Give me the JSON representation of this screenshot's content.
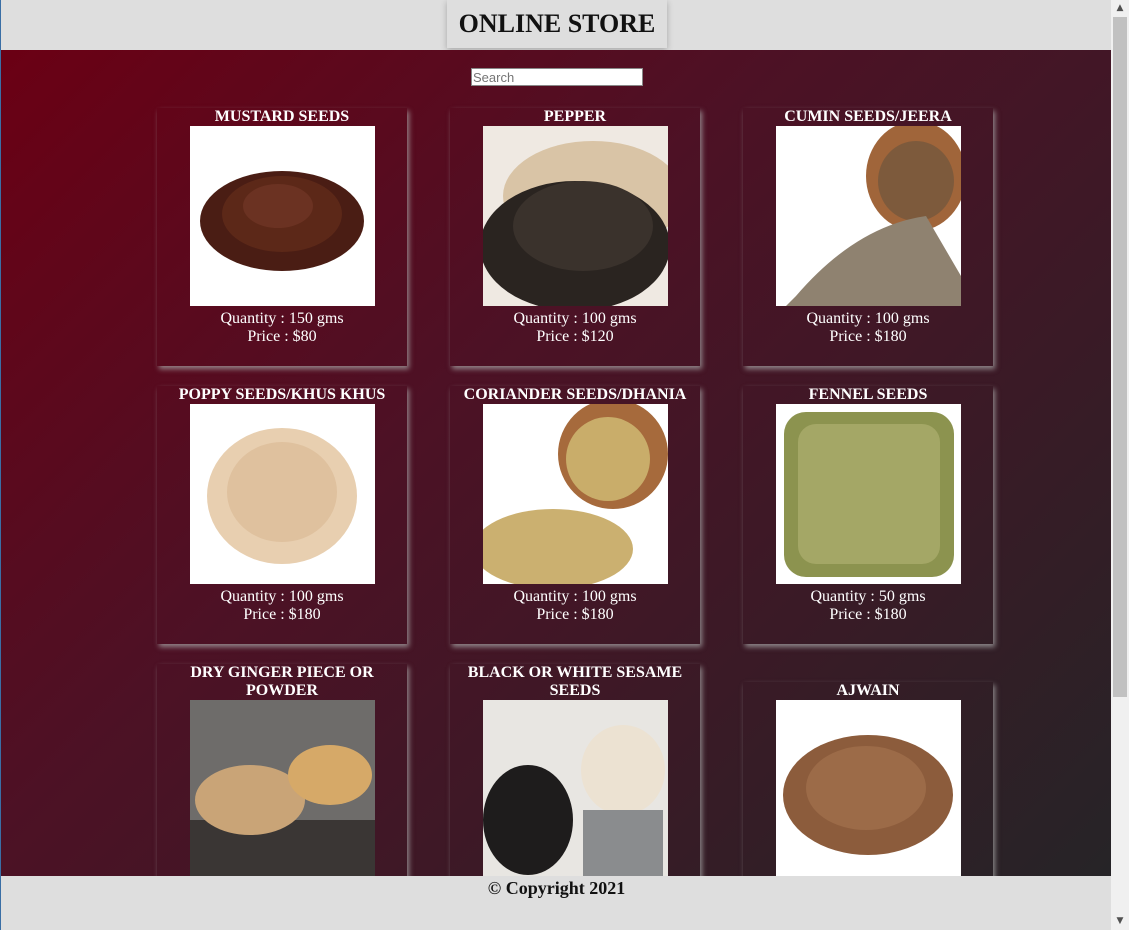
{
  "header": {
    "title": "ONLINE STORE"
  },
  "search": {
    "placeholder": "Search"
  },
  "products": [
    {
      "name": "MUSTARD SEEDS",
      "quantity": "Quantity : 150 gms",
      "price": "Price : $80",
      "image": "mustard-seeds"
    },
    {
      "name": "PEPPER",
      "quantity": "Quantity : 100 gms",
      "price": "Price : $120",
      "image": "black-pepper"
    },
    {
      "name": "CUMIN SEEDS/JEERA",
      "quantity": "Quantity : 100 gms",
      "price": "Price : $180",
      "image": "cumin-seeds"
    },
    {
      "name": "POPPY SEEDS/KHUS KHUS",
      "quantity": "Quantity : 100 gms",
      "price": "Price : $180",
      "image": "poppy-seeds"
    },
    {
      "name": "CORIANDER SEEDS/DHANIA",
      "quantity": "Quantity : 100 gms",
      "price": "Price : $180",
      "image": "coriander-seeds"
    },
    {
      "name": "FENNEL SEEDS",
      "quantity": "Quantity : 50 gms",
      "price": "Price : $180",
      "image": "fennel-seeds"
    },
    {
      "name": "DRY GINGER PIECE OR POWDER",
      "quantity": "",
      "price": "",
      "image": "dry-ginger"
    },
    {
      "name": "BLACK OR WHITE SESAME SEEDS",
      "quantity": "",
      "price": "",
      "image": "sesame-seeds"
    },
    {
      "name": "AJWAIN",
      "quantity": "",
      "price": "",
      "image": "ajwain"
    }
  ],
  "footer": {
    "copyright": "© Copyright 2021"
  },
  "colors": {
    "accent": "#6b0014",
    "header_bg": "#dedede",
    "text_on_dark": "#ffffff"
  }
}
